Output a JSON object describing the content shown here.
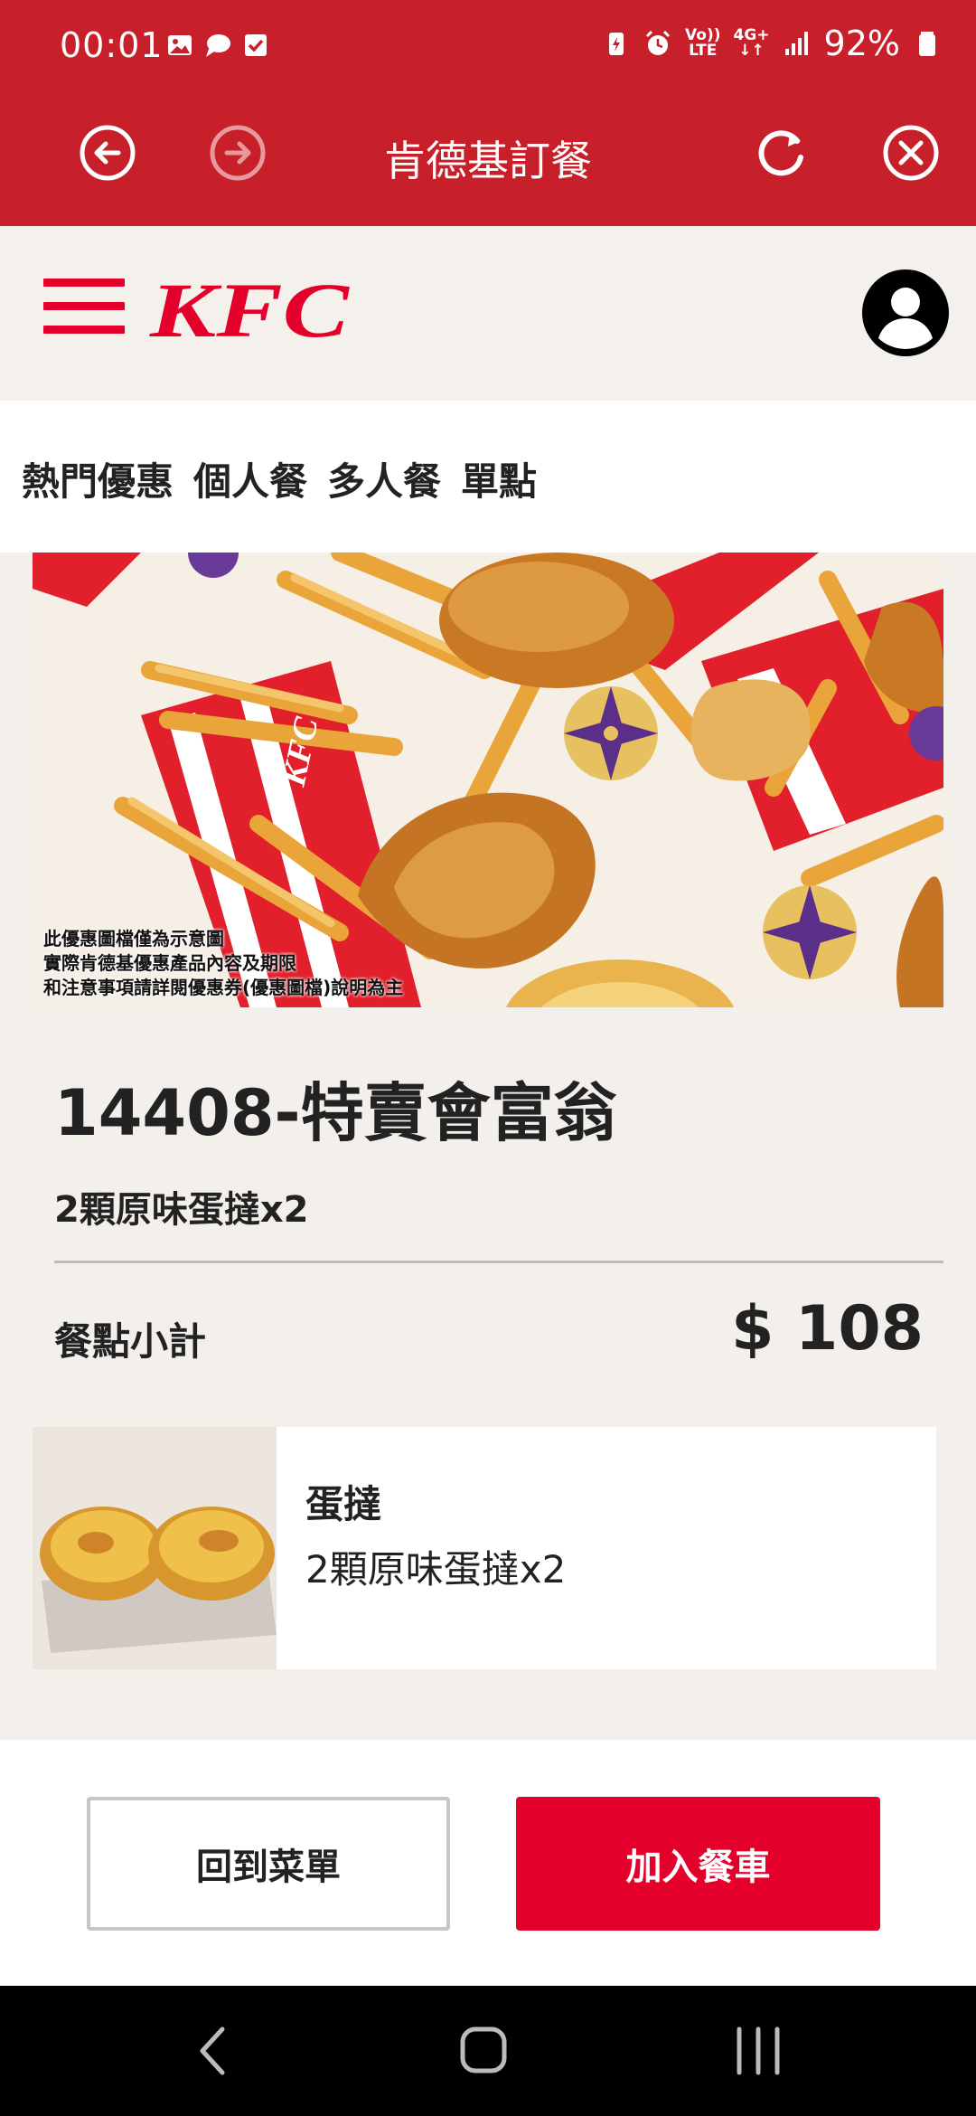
{
  "status_bar": {
    "time": "00:01",
    "volte_top": "Vo))",
    "volte_bottom": "LTE",
    "network": "4G+",
    "battery_percent": "92%",
    "icons": [
      "gallery-icon",
      "chat-bubble-icon",
      "checkbox-icon",
      "battery-saver-icon",
      "alarm-icon",
      "signal-icon",
      "battery-icon"
    ]
  },
  "browser": {
    "title": "肯德基訂餐",
    "back_icon": "back-arrow-icon",
    "forward_icon": "forward-arrow-icon",
    "reload_icon": "reload-icon",
    "close_icon": "close-icon"
  },
  "header": {
    "logo_text": "KFC",
    "menu_icon": "hamburger-menu-icon",
    "account_icon": "account-icon"
  },
  "categories": [
    "熱門優惠",
    "個人餐",
    "多人餐",
    "單點"
  ],
  "hero": {
    "disclaimer": [
      "此優惠圖檔僅為示意圖",
      "實際肯德基優惠產品內容及期限",
      "和注意事項請詳閱優惠券(優惠圖檔)說明為主"
    ]
  },
  "product": {
    "title": "14408-特賣會富翁",
    "subtitle": "2顆原味蛋撻x2",
    "subtotal_label": "餐點小計",
    "subtotal_value": "$ 108"
  },
  "items": [
    {
      "name": "蛋撻",
      "desc": "2顆原味蛋撻x2"
    }
  ],
  "actions": {
    "back_label": "回到菜單",
    "add_label": "加入餐車"
  },
  "colors": {
    "brand_red": "#c8202a",
    "kfc_red": "#e4002b",
    "background": "#f3efeb"
  }
}
